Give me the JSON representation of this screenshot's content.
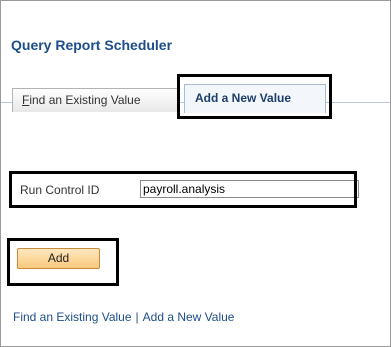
{
  "page": {
    "title": "Query Report Scheduler"
  },
  "tabs": {
    "find_prefix": "F",
    "find_rest": "ind an Existing Value",
    "add_new": "Add a New Value",
    "active": "Add a New Value"
  },
  "form": {
    "run_control_label": "Run Control ID",
    "run_control_value": "payroll.analysis"
  },
  "buttons": {
    "add_label": "Add"
  },
  "footer": {
    "find_link": "Find an Existing Value",
    "separator": "|",
    "add_link": "Add a New Value"
  },
  "colors": {
    "title": "#1d4e89",
    "button_fill": "#f9c97d",
    "callout_border": "#000000"
  }
}
